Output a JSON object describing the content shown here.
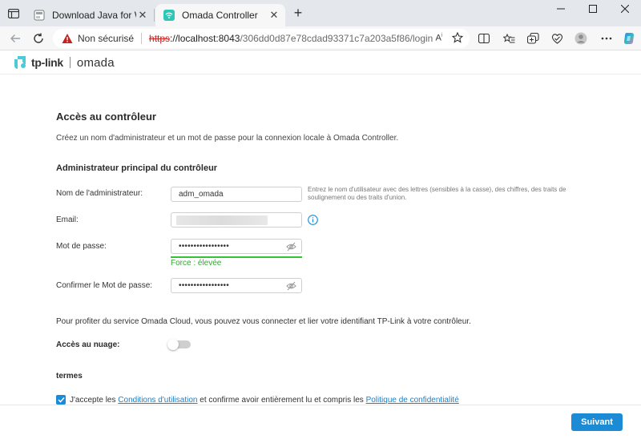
{
  "browser": {
    "tabs": [
      {
        "title": "Download Java for Windows"
      },
      {
        "title": "Omada Controller"
      }
    ],
    "security_label": "Non sécurisé",
    "url": {
      "scheme": "https",
      "rest_host": "://localhost:8043",
      "path": "/306dd0d87e78cdad93371c7a203a5f86/login"
    },
    "colors": {
      "insecure": "#c5221f"
    }
  },
  "header": {
    "brand": "tp-link",
    "product": "omada"
  },
  "page": {
    "title": "Accès au contrôleur",
    "description": "Créez un nom d'administrateur et un mot de passe pour la connexion locale à Omada Controller.",
    "section_title": "Administrateur principal du contrôleur",
    "form": {
      "admin_label": "Nom de l'administrateur:",
      "admin_value": "adm_omada",
      "admin_hint": "Entrez le nom d'utilisateur avec des lettres (sensibles à la casse), des chiffres, des traits de soulignement ou des traits d'union.",
      "email_label": "Email:",
      "password_label": "Mot de passe:",
      "password_value": "•••••••••••••••••",
      "strength_text": "Force : élevée",
      "confirm_label": "Confirmer le Mot de passe:",
      "confirm_value": "•••••••••••••••••"
    },
    "cloud": {
      "description": "Pour profiter du service Omada Cloud, vous pouvez vous connecter et lier votre identifiant TP-Link à votre contrôleur.",
      "label": "Accès au nuage:",
      "enabled": false
    },
    "terms": {
      "title": "termes",
      "checked": true,
      "text_1": "J'accepte les ",
      "link_1": "Conditions d'utilisation",
      "text_2": " et confirme avoir entièrement lu et compris les ",
      "link_2": "Politique de confidentialité"
    }
  },
  "footer": {
    "next_button": "Suivant"
  },
  "icons": {
    "favicon_java": "java-icon",
    "favicon_omada": "omada-wifi-icon",
    "info": "info-icon",
    "eye": "eye-slash-icon"
  },
  "theme": {
    "accent": "#1b8bd6",
    "strength": "#35c235"
  }
}
